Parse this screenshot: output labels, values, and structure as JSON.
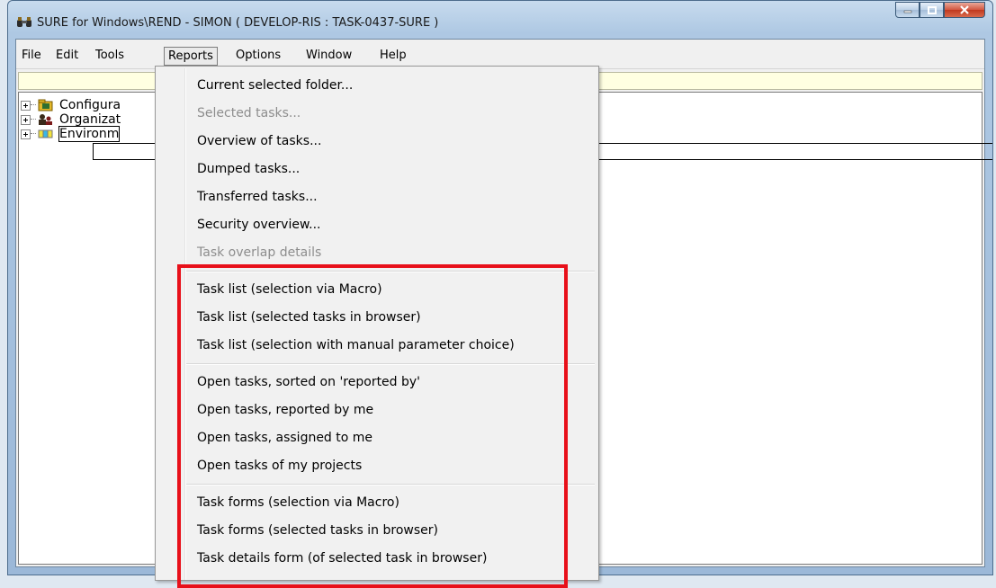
{
  "window": {
    "title": "SURE for Windows\\REND - SIMON ( DEVELOP-RIS : TASK-0437-SURE )",
    "app_icon": "binoculars-icon"
  },
  "caption_buttons": {
    "minimize_icon": "minimize-icon",
    "maximize_icon": "maximize-icon",
    "close_icon": "close-icon"
  },
  "menubar": {
    "items": [
      "File",
      "Edit",
      "Tools",
      "Reports",
      "Options",
      "Window",
      "Help"
    ],
    "active": "Reports"
  },
  "tree": {
    "items": [
      {
        "label": "Configura",
        "icon": "configuration-icon"
      },
      {
        "label": "Organizat",
        "icon": "organization-icon"
      },
      {
        "label": "Environm",
        "icon": "environment-icon",
        "focused": true
      }
    ]
  },
  "reports_menu": {
    "items": [
      {
        "label": "Current selected folder...",
        "enabled": true
      },
      {
        "label": "Selected tasks...",
        "enabled": false
      },
      {
        "label": "Overview of tasks...",
        "enabled": true
      },
      {
        "label": "Dumped tasks...",
        "enabled": true
      },
      {
        "label": "Transferred tasks...",
        "enabled": true
      },
      {
        "label": "Security overview...",
        "enabled": true
      },
      {
        "label": "Task overlap details",
        "enabled": false
      },
      {
        "label": "Task list (selection via Macro)",
        "enabled": true
      },
      {
        "label": "Task list (selected tasks in browser)",
        "enabled": true
      },
      {
        "label": "Task list (selection with manual parameter choice)",
        "enabled": true
      },
      {
        "label": "Open tasks, sorted on 'reported by'",
        "enabled": true
      },
      {
        "label": "Open tasks, reported by me",
        "enabled": true
      },
      {
        "label": "Open tasks, assigned to me",
        "enabled": true
      },
      {
        "label": "Open tasks of my projects",
        "enabled": true
      },
      {
        "label": "Task forms (selection via Macro)",
        "enabled": true
      },
      {
        "label": "Task forms (selected tasks in browser)",
        "enabled": true
      },
      {
        "label": "Task details form (of selected task in browser)",
        "enabled": true
      }
    ]
  },
  "annotation": {
    "highlight_color": "#e8101a"
  }
}
